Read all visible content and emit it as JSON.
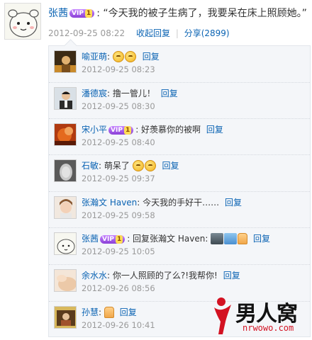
{
  "post": {
    "author": "张茜",
    "vip_badge": "VIP",
    "vip_level": "1",
    "text": ": “今天我的被子生病了，我要呆在床上照顾她。”",
    "time": "2012-09-25 08:22",
    "collapse_label": "收起回复",
    "share_label": "分享(2899)"
  },
  "comments": [
    {
      "name": "喻亚萌",
      "text": ":",
      "time": "2012-09-25 08:23",
      "reply": "回复"
    },
    {
      "name": "潘德宸",
      "text": ": 撸一管儿！",
      "time": "2012-09-25 08:30",
      "reply": "回复"
    },
    {
      "name": "宋小平",
      "vip_badge": "VIP",
      "vip_level": "1",
      "text": ": 好羡慕你的被啊",
      "time": "2012-09-25 08:40",
      "reply": "回复"
    },
    {
      "name": "石敏",
      "text": ": 萌呆了",
      "time": "2012-09-25 09:37",
      "reply": "回复"
    },
    {
      "name": "张瀚文 Haven",
      "text": ": 今天我的手好干……",
      "time": "2012-09-25 09:58",
      "reply": "回复"
    },
    {
      "name": "张茜",
      "vip_badge": "VIP",
      "vip_level": "1",
      "text": ": 回复张瀚文 Haven:",
      "time": "2012-09-25 10:05",
      "reply": "回复"
    },
    {
      "name": "余水水",
      "text": ": 你一人照顾的了么?!我帮你!",
      "time": "2012-09-26 08:56",
      "reply": "回复"
    },
    {
      "name": "孙慧",
      "text": ":",
      "time": "2012-09-26 10:41",
      "reply": "回复"
    }
  ],
  "watermark": {
    "brand": "男人窝",
    "url": "nrwowo.com"
  },
  "colors": {
    "link": "#0a63b3",
    "meta": "#9a9a9a",
    "panel_bg": "#f4f6f9",
    "watermark_red": "#d31222"
  }
}
